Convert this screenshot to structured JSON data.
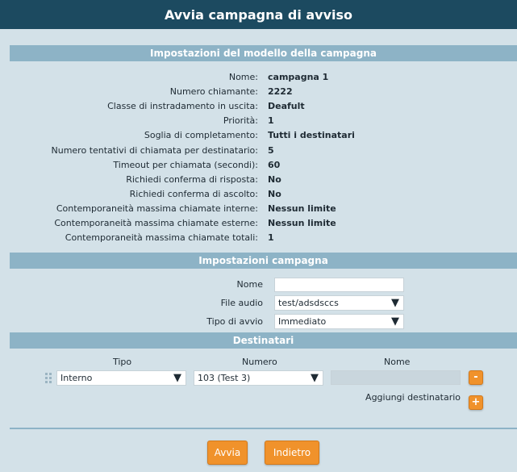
{
  "window": {
    "title": "Avvia campagna di avviso"
  },
  "model_section": {
    "title": "Impostazioni del modello della campagna",
    "rows": [
      {
        "label": "Nome:",
        "value": "campagna 1"
      },
      {
        "label": "Numero chiamante:",
        "value": "2222"
      },
      {
        "label": "Classe di instradamento in uscita:",
        "value": "Deafult"
      },
      {
        "label": "Priorità:",
        "value": "1"
      },
      {
        "label": "Soglia di completamento:",
        "value": "Tutti i destinatari"
      },
      {
        "label": "Numero tentativi di chiamata per destinatario:",
        "value": "5"
      },
      {
        "label": "Timeout per chiamata (secondi):",
        "value": "60"
      },
      {
        "label": "Richiedi conferma di risposta:",
        "value": "No"
      },
      {
        "label": "Richiedi conferma di ascolto:",
        "value": "No"
      },
      {
        "label": "Contemporaneità massima chiamate interne:",
        "value": "Nessun limite"
      },
      {
        "label": "Contemporaneità massima chiamate esterne:",
        "value": "Nessun limite"
      },
      {
        "label": "Contemporaneità massima chiamate totali:",
        "value": "1"
      }
    ]
  },
  "campaign_section": {
    "title": "Impostazioni campagna",
    "name_label": "Nome",
    "name_value": "",
    "audio_label": "File audio",
    "audio_value": "test/adsdsccs",
    "start_label": "Tipo di avvio",
    "start_value": "Immediato"
  },
  "recipients_section": {
    "title": "Destinatari",
    "col_type": "Tipo",
    "col_number": "Numero",
    "col_name": "Nome",
    "row": {
      "type": "Interno",
      "number": "103 (Test 3)",
      "name": ""
    },
    "remove_label": "-",
    "add_label": "Aggiungi destinatario",
    "add_symbol": "+"
  },
  "actions": {
    "start": "Avvia",
    "back": "Indietro"
  },
  "colors": {
    "title_bar": "#1c4a60",
    "section_header": "#8db3c6",
    "background": "#d3e1e8",
    "accent": "#f0922b"
  },
  "icons": {
    "dropdown": "triangle-down",
    "drag": "drag-handle"
  }
}
